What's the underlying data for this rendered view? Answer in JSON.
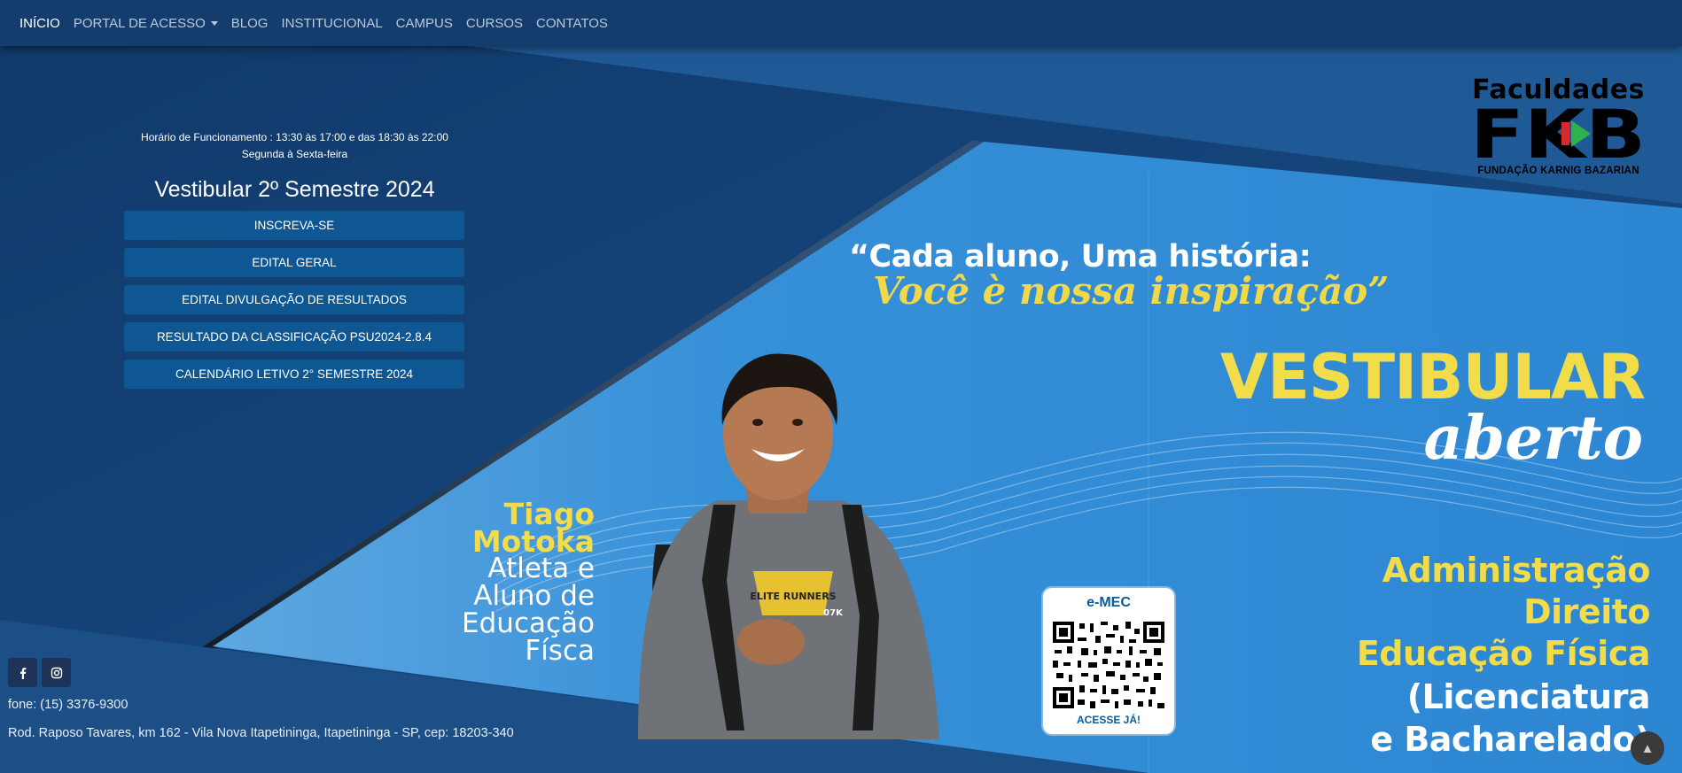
{
  "nav": {
    "items": [
      {
        "label": "INÍCIO",
        "active": true
      },
      {
        "label": "PORTAL DE ACESSO",
        "dropdown": true
      },
      {
        "label": "BLOG"
      },
      {
        "label": "INSTITUCIONAL"
      },
      {
        "label": "CAMPUS"
      },
      {
        "label": "CURSOS"
      },
      {
        "label": "CONTATOS"
      }
    ]
  },
  "info": {
    "hours_line1": "Horário de Funcionamento : 13:30 às 17:00 e das 18:30 às 22:00",
    "hours_line2": "Segunda à Sexta-feira",
    "title": "Vestibular 2º Semestre 2024",
    "buttons": [
      {
        "label": "INSCREVA-SE"
      },
      {
        "label": "EDITAL GERAL"
      },
      {
        "label": "EDITAL DIVULGAÇÃO DE RESULTADOS"
      },
      {
        "label": "RESULTADO DA CLASSIFICAÇÃO PSU2024-2.8.4"
      },
      {
        "label": "CALENDÁRIO LETIVO 2° SEMESTRE 2024"
      }
    ]
  },
  "footer": {
    "social": [
      {
        "icon": "facebook-icon"
      },
      {
        "icon": "instagram-icon"
      }
    ],
    "phone": "fone: (15) 3376-9300",
    "address": "Rod. Raposo Tavares, km 162 - Vila Nova Itapetininga, Itapetininga - SP, cep: 18203-340"
  },
  "scroll_top": {
    "icon": "arrow-up-icon",
    "glyph": "▲"
  },
  "banner": {
    "logo_word": "Faculdades",
    "logo_letters": "FKB",
    "logo_sub": "FUNDAÇÃO KARNIG BAZARIAN",
    "quote_line1": "“Cada aluno, Uma história:",
    "quote_line2": "Você è nossa inspiração”",
    "vestibular": "VESTIBULAR",
    "aberto": "aberto",
    "athlete_first": "Tiago",
    "athlete_last": "Motoka",
    "athlete_desc": [
      "Atleta e",
      "Aluno de",
      "Educação",
      "Físca"
    ],
    "qr_title": "e-MEC",
    "qr_cta": "ACESSE JÁ!",
    "shirt_text": "ELITE RUNNERS",
    "shirt_badge": "07K",
    "courses": [
      {
        "label": "Administração",
        "color": "yellow"
      },
      {
        "label": "Direito",
        "color": "yellow"
      },
      {
        "label": "Educação Física",
        "color": "yellow"
      },
      {
        "label": "(Licenciatura",
        "color": "white"
      },
      {
        "label": "e Bacharelado)",
        "color": "white"
      }
    ]
  },
  "colors": {
    "navbar": "#143d6d",
    "background": "#1b4f86",
    "banner_blue": "#2f8ad4",
    "button": "#0e5792",
    "accent_yellow": "#f2dc4a"
  }
}
